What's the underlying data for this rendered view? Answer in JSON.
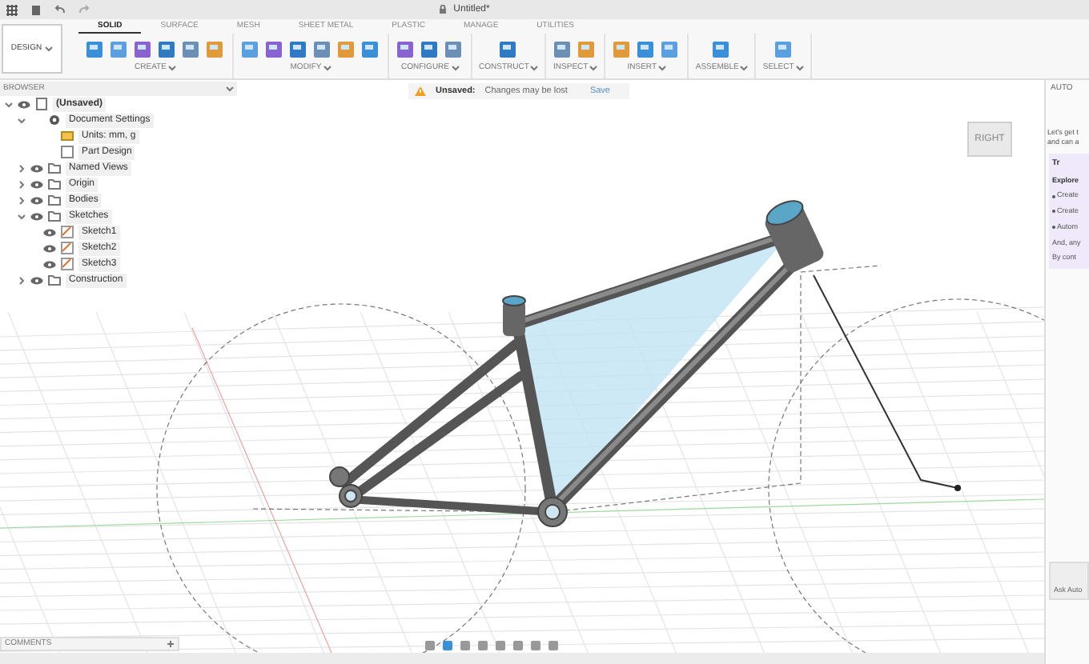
{
  "window": {
    "title": "Untitled*"
  },
  "tabs": [
    {
      "label": "SOLID",
      "selected": true
    },
    {
      "label": "SURFACE",
      "selected": false
    },
    {
      "label": "MESH",
      "selected": false
    },
    {
      "label": "SHEET METAL",
      "selected": false
    },
    {
      "label": "PLASTIC",
      "selected": false
    },
    {
      "label": "MANAGE",
      "selected": false
    },
    {
      "label": "UTILITIES",
      "selected": false
    }
  ],
  "workspace": {
    "label": "DESIGN"
  },
  "groups": [
    {
      "label": "CREATE"
    },
    {
      "label": "MODIFY"
    },
    {
      "label": "CONFIGURE"
    },
    {
      "label": "CONSTRUCT"
    },
    {
      "label": "INSPECT"
    },
    {
      "label": "INSERT"
    },
    {
      "label": "ASSEMBLE"
    },
    {
      "label": "SELECT"
    }
  ],
  "banner": {
    "status": "Unsaved:",
    "message": "Changes may be lost",
    "action": "Save"
  },
  "browser": {
    "title": "BROWSER",
    "items": [
      {
        "label": "(Unsaved)",
        "kind": "document",
        "expanded": true,
        "children": [
          {
            "label": "Document Settings",
            "kind": "settings",
            "expanded": true,
            "children": [
              {
                "label": "Units: mm, g",
                "kind": "units"
              },
              {
                "label": "Part Design",
                "kind": "design"
              }
            ]
          },
          {
            "label": "Named Views",
            "kind": "folder",
            "expanded": false
          },
          {
            "label": "Origin",
            "kind": "folder",
            "expanded": false
          },
          {
            "label": "Bodies",
            "kind": "folder",
            "expanded": false
          },
          {
            "label": "Sketches",
            "kind": "folder",
            "expanded": true,
            "children": [
              {
                "label": "Sketch1",
                "kind": "sketch"
              },
              {
                "label": "Sketch2",
                "kind": "sketch"
              },
              {
                "label": "Sketch3",
                "kind": "sketch"
              }
            ]
          },
          {
            "label": "Construction",
            "kind": "folder",
            "expanded": false
          }
        ]
      }
    ]
  },
  "view_cube": {
    "label": "RIGHT"
  },
  "assistant": {
    "header": "AUTO",
    "intro": [
      "Let's get t",
      "and can a"
    ],
    "card_title": "Tr",
    "card_heading": "Explore",
    "bullets": [
      "Create",
      "Create",
      "Autom"
    ],
    "lines": [
      "And, any",
      "By cont"
    ],
    "ask": "Ask Auto"
  },
  "comments": {
    "title": "COMMENTS"
  }
}
